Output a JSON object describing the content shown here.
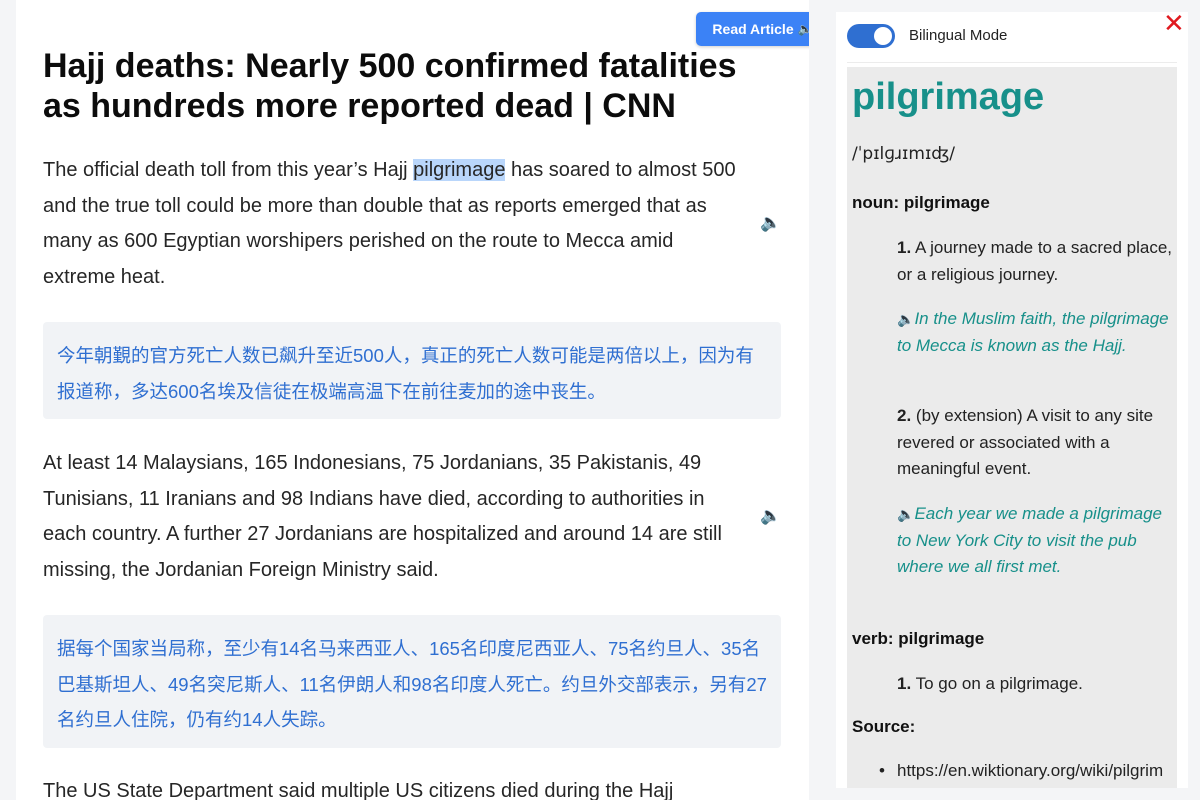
{
  "article": {
    "read_button_label": "Read Article",
    "title": "Hajj deaths: Nearly 500 confirmed fatalities as hundreds more reported dead | CNN",
    "p1_before": "The official death toll from this year’s Hajj ",
    "p1_highlight": "pilgrimage",
    "p1_after": " has soared to almost 500 and the true toll could be more than double that as reports emerged that as many as 600 Egyptian worshipers perished on the route to Mecca amid extreme heat.",
    "t1": "今年朝覲的官方死亡人数已飙升至近500人，真正的死亡人数可能是两倍以上，因为有报道称，多达600名埃及信徒在极端高温下在前往麦加的途中丧生。",
    "p2": "At least 14 Malaysians, 165 Indonesians, 75 Jordanians, 35 Pakistanis, 49 Tunisians, 11 Iranians and 98 Indians have died, according to authorities in each country. A further 27 Jordanians are hospitalized and around 14 are still missing, the Jordanian Foreign Ministry said.",
    "t2": "据每个国家当局称，至少有14名马来西亚人、165名印度尼西亚人、75名约旦人、35名巴基斯坦人、49名突尼斯人、11名伊朗人和98名印度人死亡。约旦外交部表示，另有27名约旦人住院，仍有约14人失踪。",
    "p3": "The US State Department said multiple US citizens died during the Hajj"
  },
  "dictionary": {
    "bilingual_label": "Bilingual Mode",
    "bilingual_on": true,
    "word": "pilgrimage",
    "ipa": "/ˈpɪlɡɹɪmɪʤ/",
    "noun_label": "noun: pilgrimage",
    "def1_num": "1.",
    "def1": "A journey made to a sacred place, or a religious journey.",
    "ex1": "In the Muslim faith, the pilgrimage to Mecca is known as the Hajj.",
    "def2_num": "2.",
    "def2": "(by extension) A visit to any site revered or associated with a meaningful event.",
    "ex2": "Each year we made a pilgrimage to New York City to visit the pub where we all first met.",
    "verb_label": "verb: pilgrimage",
    "def3_num": "1.",
    "def3": "To go on a pilgrimage.",
    "source_label": "Source:",
    "source_url": "https://en.wiktionary.org/wiki/pilgrim"
  },
  "icons": {
    "speaker": "🔈",
    "close": "✕",
    "bullet": "•"
  },
  "colors": {
    "accent_blue": "#3b82f6",
    "toggle_blue": "#2f6fd1",
    "dict_teal": "#17908a",
    "close_red": "#e0191f",
    "highlight": "#b9d6fb"
  }
}
